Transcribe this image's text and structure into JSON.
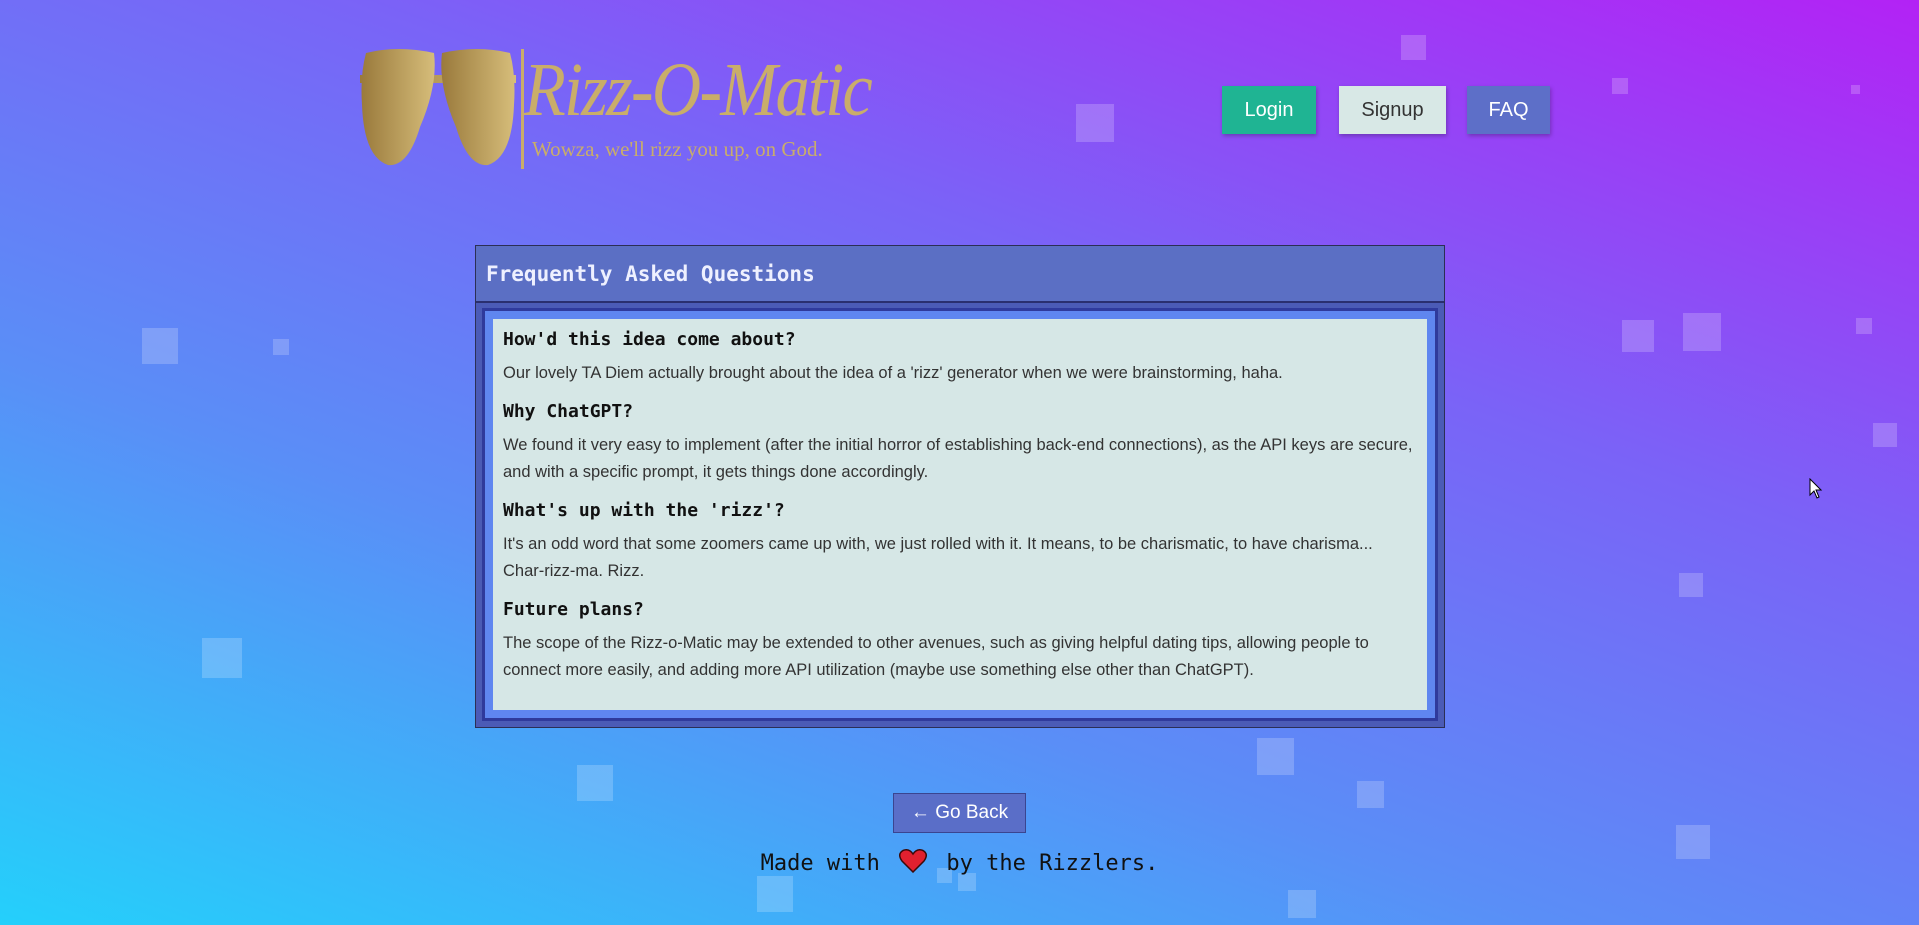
{
  "brand": {
    "title": "Rizz-O-Matic",
    "tagline": "Wowza, we'll rizz you up, on God.",
    "logo_icon": "sunglasses-icon",
    "color": "#c9ad6a"
  },
  "nav": {
    "login": "Login",
    "signup": "Signup",
    "faq": "FAQ"
  },
  "faq": {
    "title": "Frequently Asked Questions",
    "items": [
      {
        "q": "How'd this idea come about?",
        "a": "Our lovely TA Diem actually brought about the idea of a 'rizz' generator when we were brainstorming, haha."
      },
      {
        "q": "Why ChatGPT?",
        "a": "We found it very easy to implement (after the initial horror of establishing back-end connections), as the API keys are secure, and with a specific prompt, it gets things done accordingly."
      },
      {
        "q": "What's up with the 'rizz'?",
        "a": "It's an odd word that some zoomers came up with, we just rolled with it. It means, to be charismatic, to have charisma... Char-rizz-ma. Rizz."
      },
      {
        "q": "Future plans?",
        "a": "The scope of the Rizz-o-Matic may be extended to other avenues, such as giving helpful dating tips, allowing people to connect more easily, and adding more API utilization (maybe use something else other than ChatGPT)."
      }
    ]
  },
  "back_button": "← Go Back",
  "footer": {
    "prefix": "Made with",
    "icon": "heart-icon",
    "suffix": "by the Rizzlers."
  }
}
